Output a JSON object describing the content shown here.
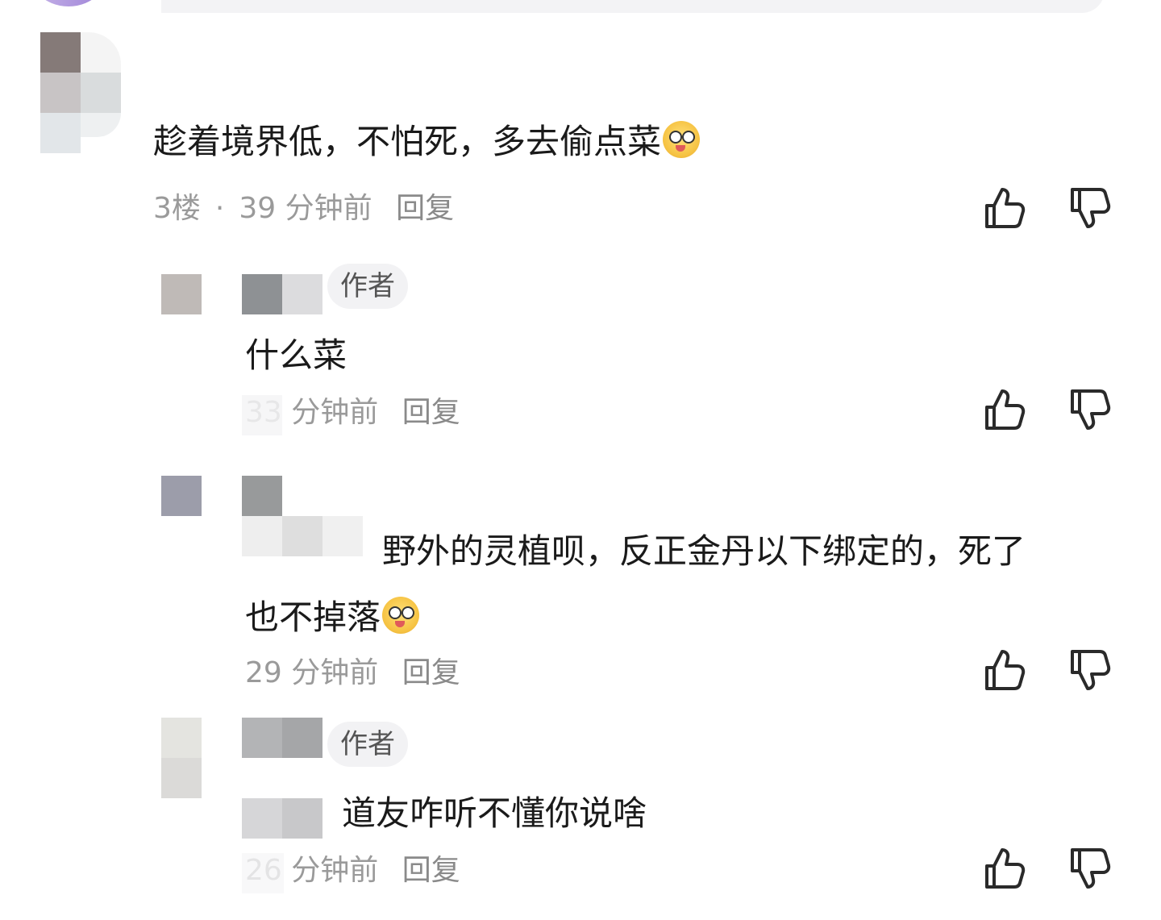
{
  "comments": [
    {
      "text": "趁着境界低，不怕死，多去偷点菜",
      "floor": "3楼",
      "separator": "·",
      "time": "39 分钟前",
      "reply": "回复",
      "emoji": "fried-chicken-laugh-emoji"
    }
  ],
  "replies": [
    {
      "tag": "作者",
      "text": "什么菜",
      "time": "33 分钟前",
      "reply": "回复"
    },
    {
      "text_line1": "野外的灵植呗，反正金丹以下绑定的，死了",
      "text_line2": "也不掉落",
      "time": "29 分钟前",
      "reply": "回复",
      "emoji": "silly-tongue-emoji"
    },
    {
      "tag": "作者",
      "text": "道友咋听不懂你说啥",
      "time": "26 分钟前",
      "reply": "回复"
    }
  ],
  "icons": {
    "like": "thumbs-up-icon",
    "dislike": "thumbs-down-icon"
  },
  "colors": {
    "text": "#1a1a1a",
    "meta": "#9a9a9a",
    "tag_bg": "#f2f2f4",
    "icon": "#2a2a2a"
  }
}
